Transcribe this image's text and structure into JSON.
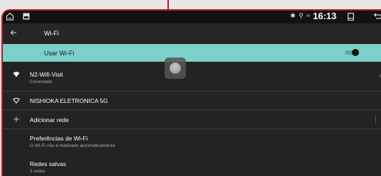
{
  "status_bar": {
    "time": "16:13",
    "glyphs": "✱ ⚲ ≈"
  },
  "header": {
    "title": "Wi-Fi"
  },
  "toggle": {
    "label": "Usar Wi-Fi",
    "on": true
  },
  "networks": [
    {
      "name": "N2-Wifi-Visit",
      "status": "Conectado",
      "edge": "8"
    },
    {
      "name": "NISHIOKA ELETRONICA 5G"
    }
  ],
  "actions": {
    "add_network": "Adicionar rede"
  },
  "preferences": {
    "title": "Preferências de Wi-Fi",
    "subtitle": "O Wi-Fi não é reativado automaticamente"
  },
  "saved": {
    "title": "Redes salvas",
    "subtitle": "3 redes"
  },
  "colors": {
    "accent_row": "#7ccfca",
    "frame_border": "#c3161d",
    "background": "#232323"
  }
}
